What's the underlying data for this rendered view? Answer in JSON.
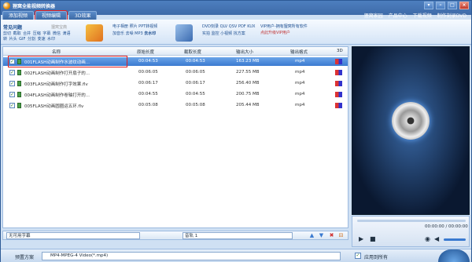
{
  "app": {
    "title": "狸窝全能视频转换器"
  },
  "tabs": [
    {
      "label": "添加视频"
    },
    {
      "label": "视频编辑"
    },
    {
      "label": "3D效果"
    }
  ],
  "top_links": [
    "狸窝家园",
    "产品中心",
    "下载视频",
    "制作刻录DVD"
  ],
  "toolbar": {
    "faq_title": "常见问题",
    "faq_sub": "狸窝宝典",
    "quick_links": "剪切 截取 合并 压缩 字幕 微信 滴语 转 片头 GIF 分割 变速 水印",
    "group2_line1": "电子相册 照片 PPT转视频",
    "group2_line2": "加音乐 去噪 MP3",
    "group2_bold": "去水印",
    "group3_line1": "DVD刻录 QLV QSV PDF KUX",
    "group3_line2": "实拍 监控 小视频 找方案",
    "vip_line1": "VIP用户-拥有狸窝所有软件",
    "vip_line2": "点此升级VIP用户"
  },
  "table": {
    "headers": [
      "名称",
      "原始长度",
      "截取长度",
      "输出大小",
      "输出格式",
      "3D"
    ],
    "rows": [
      {
        "name": "001FLASH动画制作水波纹动画...",
        "orig": "00:04:53",
        "cut": "00:04:53",
        "size": "163.23 MB",
        "format": "mp4"
      },
      {
        "name": "002FLASH动画制作打开扇子的...",
        "orig": "00:06:05",
        "cut": "00:06:05",
        "size": "227.55 MB",
        "format": "mp4"
      },
      {
        "name": "003FLASH动画制作打字效果.flv",
        "orig": "00:06:17",
        "cut": "00:06:17",
        "size": "256.40 MB",
        "format": "mp4"
      },
      {
        "name": "004FLASH动画制作卷轴打开的...",
        "orig": "00:04:55",
        "cut": "00:04:55",
        "size": "200.75 MB",
        "format": "mp4"
      },
      {
        "name": "005FLASH动画圆圈运五环.flv",
        "orig": "00:05:08",
        "cut": "00:05:08",
        "size": "205.44 MB",
        "format": "mp4"
      }
    ]
  },
  "bottom": {
    "subtitle_value": "无可用字幕",
    "audio_value": "音轨 1",
    "preset_label": "预置方案",
    "preset_value": "MP4-MPEG-4 Video(*.mp4)",
    "apply_all": "应用到所有"
  },
  "player": {
    "time": "00:00:00 / 00:00:00"
  }
}
